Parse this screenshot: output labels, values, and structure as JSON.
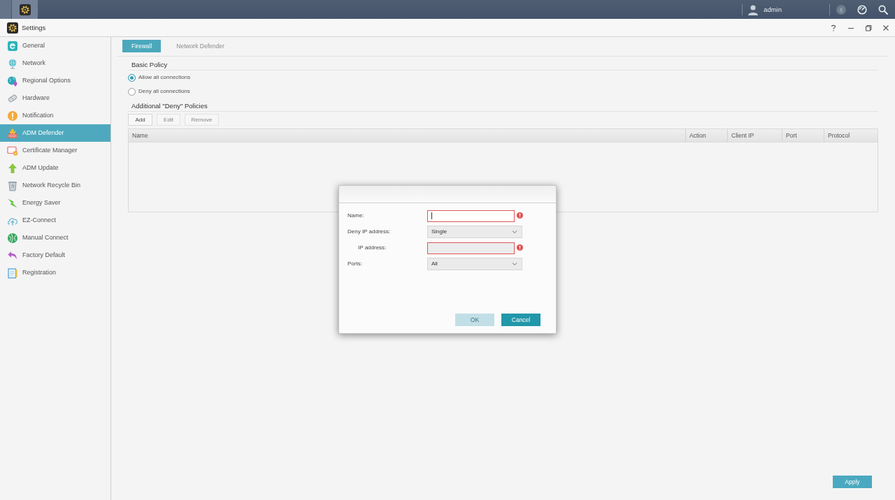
{
  "top_bar": {
    "user_name": "admin"
  },
  "window": {
    "title": "Settings"
  },
  "sidebar": {
    "items": [
      {
        "label": "General",
        "selected": false
      },
      {
        "label": "Network",
        "selected": false
      },
      {
        "label": "Regional Options",
        "selected": false
      },
      {
        "label": "Hardware",
        "selected": false
      },
      {
        "label": "Notification",
        "selected": false
      },
      {
        "label": "ADM Defender",
        "selected": true
      },
      {
        "label": "Certificate Manager",
        "selected": false
      },
      {
        "label": "ADM Update",
        "selected": false
      },
      {
        "label": "Network Recycle Bin",
        "selected": false
      },
      {
        "label": "Energy Saver",
        "selected": false
      },
      {
        "label": "EZ-Connect",
        "selected": false
      },
      {
        "label": "Manual Connect",
        "selected": false
      },
      {
        "label": "Factory Default",
        "selected": false
      },
      {
        "label": "Registration",
        "selected": false
      }
    ]
  },
  "tabs": [
    {
      "label": "Firewall",
      "selected": true
    },
    {
      "label": "Network Defender",
      "selected": false
    }
  ],
  "basic_policy": {
    "title": "Basic Policy",
    "options": [
      {
        "label": "Allow all connections",
        "selected": true
      },
      {
        "label": "Deny all connections",
        "selected": false
      }
    ]
  },
  "deny_policies": {
    "title": "Additional \"Deny\" Policies",
    "buttons": [
      {
        "label": "Add",
        "disabled": false
      },
      {
        "label": "Edit",
        "disabled": true
      },
      {
        "label": "Remove",
        "disabled": true
      }
    ],
    "table": {
      "columns": [
        "Name",
        "Action",
        "Client IP",
        "Port",
        "Protocol"
      ]
    }
  },
  "dialog": {
    "fields": [
      {
        "kind": "text",
        "label": "Name:",
        "focused": true,
        "invalid": true
      },
      {
        "kind": "select",
        "label": "Deny IP address:",
        "value": "Single",
        "children": [
          {
            "kind": "text",
            "label": "IP address:",
            "focused": false,
            "invalid": true
          }
        ]
      },
      {
        "kind": "select",
        "label": "Ports:",
        "value": "All"
      }
    ],
    "buttons": [
      {
        "label": "OK",
        "disabled": true
      },
      {
        "label": "Cancel",
        "disabled": false
      }
    ]
  },
  "apply_button": {
    "label": "Apply"
  }
}
